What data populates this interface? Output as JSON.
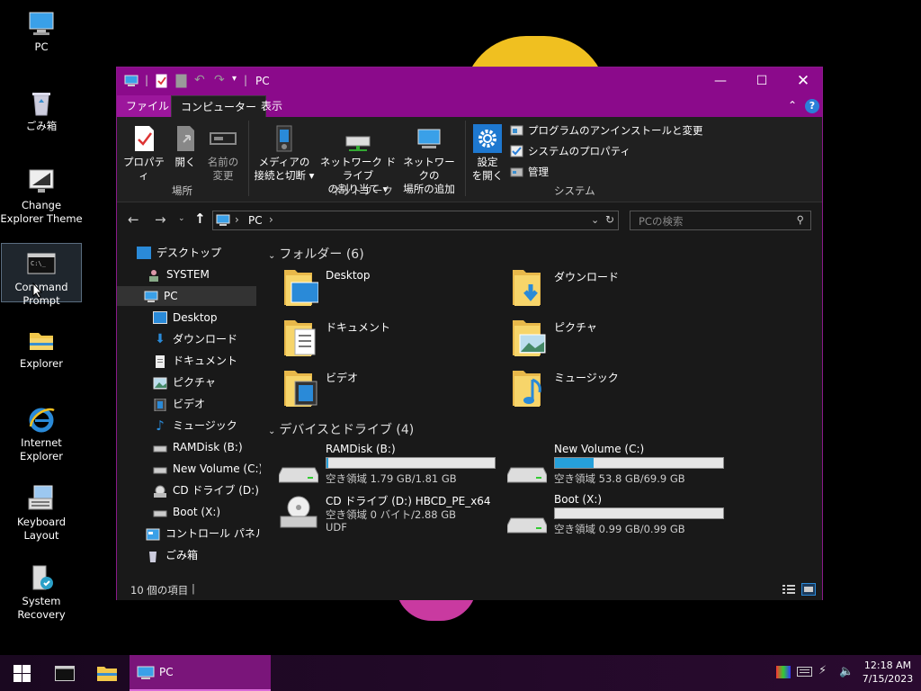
{
  "desktop": {
    "icons": [
      {
        "label": "PC"
      },
      {
        "label": "ごみ箱"
      },
      {
        "label": "Change Explorer Theme"
      },
      {
        "label": "Command Prompt"
      },
      {
        "label": "Explorer"
      },
      {
        "label": "Internet Explorer"
      },
      {
        "label": "Keyboard Layout"
      },
      {
        "label": "System Recovery"
      }
    ]
  },
  "window": {
    "title": "PC",
    "ribbon_tabs": [
      "ファイル",
      "コンピューター",
      "表示"
    ],
    "ribbon": {
      "properties": "プロパティ",
      "open": "開く",
      "rename_1": "名前の",
      "rename_2": "変更",
      "group_location": "場所",
      "media_1": "メディアの",
      "media_2": "接続と切断 ▾",
      "netdrive_1": "ネットワーク ドライブ",
      "netdrive_2": "の割り当て ▾",
      "netloc_1": "ネットワークの",
      "netloc_2": "場所の追加",
      "group_network": "ネットワーク",
      "settings_1": "設定",
      "settings_2": "を開く",
      "uninstall": "プログラムのアンインストールと変更",
      "sysprops": "システムのプロパティ",
      "manage": "管理",
      "group_system": "システム"
    },
    "address": {
      "path": "PC",
      "sep": "›"
    },
    "search_placeholder": "PCの検索",
    "nav": [
      "デスクトップ",
      "SYSTEM",
      "PC",
      "Desktop",
      "ダウンロード",
      "ドキュメント",
      "ピクチャ",
      "ビデオ",
      "ミュージック",
      "RAMDisk (B:)",
      "New Volume (C:)",
      "CD ドライブ (D:) HBC",
      "Boot (X:)",
      "コントロール パネル",
      "ごみ箱"
    ],
    "folders_header": "フォルダー (6)",
    "folders": [
      "Desktop",
      "ダウンロード",
      "ドキュメント",
      "ピクチャ",
      "ビデオ",
      "ミュージック"
    ],
    "drives_header": "デバイスとドライブ (4)",
    "drives": [
      {
        "name": "RAMDisk (B:)",
        "free": "空き領域 1.79 GB/1.81 GB",
        "used_fraction": 0.01
      },
      {
        "name": "New Volume (C:)",
        "free": "空き領域 53.8 GB/69.9 GB",
        "used_fraction": 0.23
      },
      {
        "name": "CD ドライブ (D:) HBCD_PE_x64",
        "free": "空き領域 0 バイト/2.88 GB",
        "fs": "UDF"
      },
      {
        "name": "Boot (X:)",
        "free": "空き領域 0.99 GB/0.99 GB",
        "used_fraction": 0.0
      }
    ],
    "status": "10 個の項目"
  },
  "taskbar": {
    "explorer_task": "PC",
    "time": "12:18 AM",
    "date": "7/15/2023"
  },
  "colors": {
    "accent": "#8b0a8b",
    "drive_bar": "#26a0da"
  }
}
